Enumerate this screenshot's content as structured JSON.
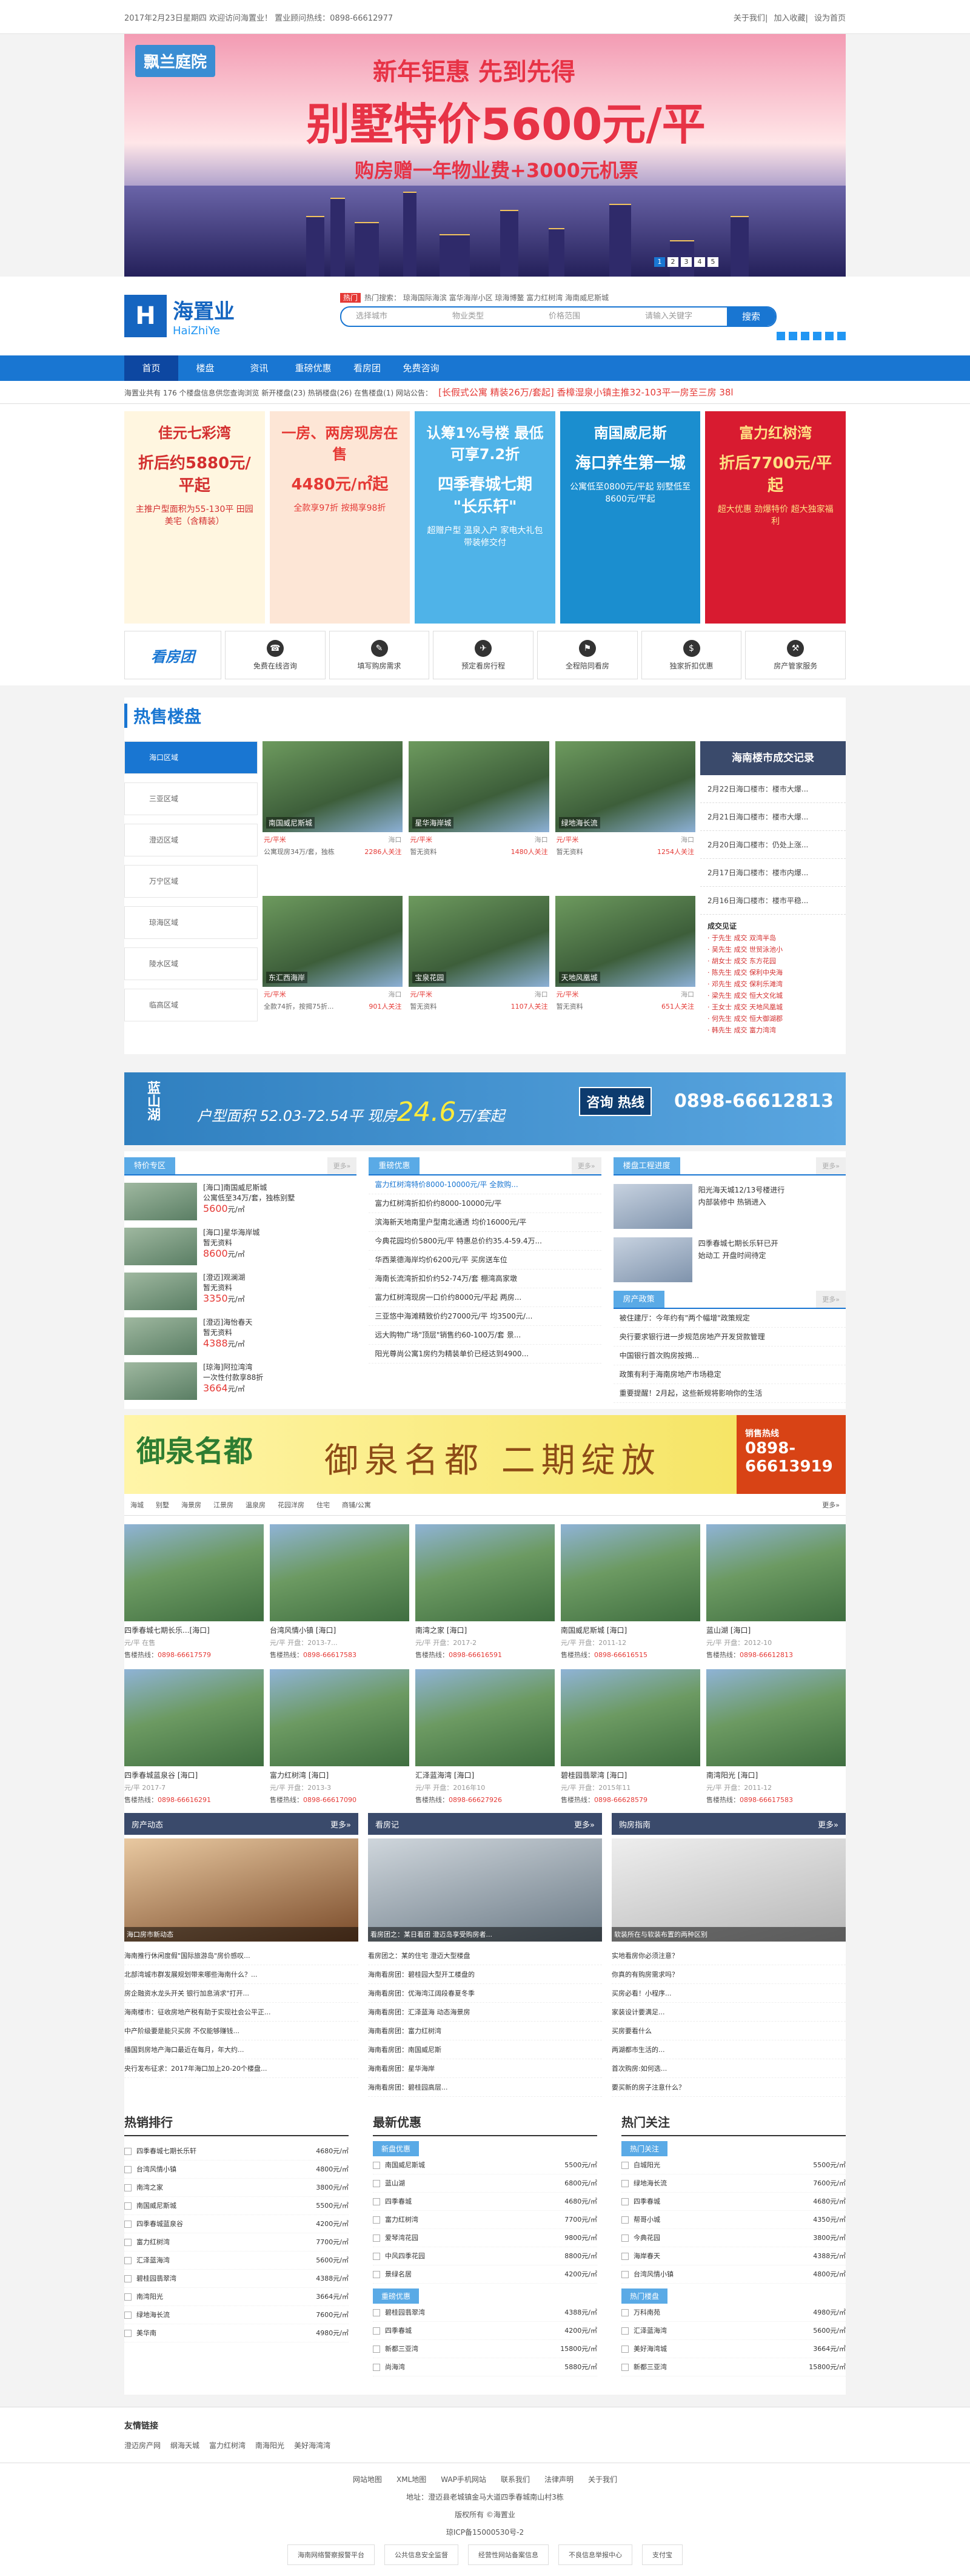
{
  "topbar": {
    "left": "2017年2月23日星期四  欢迎访问海置业！  置业顾问热线：0898-66612977",
    "links": [
      "关于我们",
      "加入收藏",
      "设为首页"
    ]
  },
  "banner": {
    "logo": "飘兰庭院",
    "t1": "新年钜惠 先到先得",
    "t2": "别墅特价5600元/平",
    "t3": "购房赠一年物业费+3000元机票",
    "dots": [
      "1",
      "2",
      "3",
      "4",
      "5"
    ]
  },
  "header": {
    "logo_cn": "海置业",
    "logo_en": "HaiZhiYe",
    "hot_tag": "热门",
    "hot_kw": "热门搜索： 琼海国际海滨  富华海岸小区  琼海博鳌  富力红树湾  海南威尼斯城",
    "s1": "选择城市",
    "s2": "物业类型",
    "s3": "价格范围",
    "s4": "请输入关键字",
    "search_btn": "搜索"
  },
  "nav": [
    "首页",
    "楼盘",
    "资讯",
    "重磅优惠",
    "看房团",
    "免费咨询"
  ],
  "ticker": {
    "text": "海置业共有 176 个楼盘信息供您查询浏览  新开楼盘(23)  热销楼盘(26)  在售楼盘(1)  网站公告：",
    "red": "[长假式公寓 精装26万/套起]   香樟湿泉小镇主推32-103平一房至三房 38l"
  },
  "promos": [
    {
      "a": "佳元七彩湾",
      "b": "折后约5880元/平起",
      "c": "主推户型面积为55-130平 田园美宅（含精装）",
      "bg": "#fff6e0",
      "fg": "#d32f2f"
    },
    {
      "a": "一房、两房现房在售",
      "b": "4480元/㎡起",
      "c": "全款享97折 按揭享98折",
      "bg": "#fde6d6",
      "fg": "#e53935"
    },
    {
      "a": "认筹1%号楼 最低可享7.2折",
      "b": "四季春城七期 \"长乐轩\"",
      "c": "超赠户型 温泉入户 家电大礼包 带装修交付",
      "bg": "#4fb3e8",
      "fg": "#fff"
    },
    {
      "a": "南国威尼斯",
      "b": "海口养生第一城",
      "c": "公寓低至0800元/平起 别墅低至8600元/平起",
      "bg": "#1b8ecf",
      "fg": "#fff"
    },
    {
      "a": "富力红树湾",
      "b": "折后7700元/平起",
      "c": "超大优惠 劲爆特价 超大独家福利",
      "bg": "#d81b30",
      "fg": "#ffe082"
    }
  ],
  "services": {
    "title": "看房团",
    "items": [
      {
        "icon": "phone-icon",
        "glyph": "☎",
        "label": "免费在线咨询"
      },
      {
        "icon": "pen-icon",
        "glyph": "✎",
        "label": "填写购房需求"
      },
      {
        "icon": "plane-icon",
        "glyph": "✈",
        "label": "预定看房行程"
      },
      {
        "icon": "flag-icon",
        "glyph": "⚑",
        "label": "全程陪同看房"
      },
      {
        "icon": "money-icon",
        "glyph": "$",
        "label": "独家折扣优惠"
      },
      {
        "icon": "wrench-icon",
        "glyph": "⚒",
        "label": "房产管家服务"
      }
    ]
  },
  "hot": {
    "title": "热售楼盘",
    "regions": [
      "海口区域",
      "三亚区域",
      "澄迈区域",
      "万宁区域",
      "琼海区域",
      "陵水区域",
      "临高区域"
    ],
    "cards": [
      {
        "name": "南国威尼斯城",
        "price": "元/平米",
        "area": "海口",
        "l2": "公寓现房34万/套，独栋",
        "att": "2286人关注"
      },
      {
        "name": "星华海岸城",
        "price": "元/平米",
        "area": "海口",
        "l2": "暂无资料",
        "att": "1480人关注"
      },
      {
        "name": "绿地海长流",
        "price": "元/平米",
        "area": "海口",
        "l2": "暂无资料",
        "att": "1254人关注"
      },
      {
        "name": "东汇西海岸",
        "price": "元/平米",
        "area": "海口",
        "l2": "全款74折，按揭75折...",
        "att": "901人关注"
      },
      {
        "name": "宝泉花园",
        "price": "元/平米",
        "area": "海口",
        "l2": "暂无资料",
        "att": "1107人关注"
      },
      {
        "name": "天地风凰城",
        "price": "元/平米",
        "area": "海口",
        "l2": "暂无资料",
        "att": "651人关注"
      }
    ]
  },
  "deals": {
    "title": "海南楼市成交记录",
    "items": [
      "2月22日海口楼市：楼市大爆...",
      "2月21日海口楼市：楼市大爆...",
      "2月20日海口楼市：仍处上涨...",
      "2月17日海口楼市：楼市内爆...",
      "2月16日海口楼市：楼市平稳..."
    ],
    "veri_title": "成交见证",
    "veri": [
      "· 于先生 成交 双湾半岛",
      "· 吴先生 成交 世贸泳池小",
      "· 胡女士 成交 东方花园",
      "· 陈先生 成交 保利中央海",
      "· 邓先生 成交 保利乐滩湾",
      "· 梁先生 成交 恒大文化城",
      "· 王女士 成交 天地风凰城",
      "· 何先生 成交 恒大御湖郡",
      "· 韩先生 成交 富力湾湾"
    ]
  },
  "ad2": {
    "a": "蓝山湖",
    "b": "户型面积",
    "nums": "52.03-72.54",
    "c": "0898-66612813",
    "d": "咨询 热线",
    "e": "现房",
    "f": "24.6",
    "g": "万/套起"
  },
  "tejia": {
    "title": "特价专区",
    "items": [
      {
        "a": "[海口]南国威尼斯城",
        "b": "公寓低至34万/套，独栋别墅",
        "p": "5600"
      },
      {
        "a": "[海口]星华海岸城",
        "b": "暂无资料",
        "p": "8600"
      },
      {
        "a": "[澄迈]观澜湖",
        "b": "暂无资料",
        "p": "3350"
      },
      {
        "a": "[澄迈]海怡春天",
        "b": "暂无资料",
        "p": "4388"
      },
      {
        "a": "[琼海]阿拉湾湾",
        "b": "一次性付款享88折",
        "p": "3664"
      }
    ],
    "unit": "元/㎡"
  },
  "youhui": {
    "title": "重磅优惠",
    "items": [
      "富力红树湾特价8000-10000元/平 全款购...",
      "富力红树湾折扣价约8000-10000元/平",
      "滨海新天地南里户型南北通透 均价16000元/平",
      "今典花园均价5800元/平 特惠总价约35.4-59.4万...",
      "华西莱德海岸均价6200元/平 买房送车位",
      "海南长流湾折扣价约52-74万/套 棚湾高家墩",
      "富力红树湾现房一口价约8000元/平起 两房...",
      "三亚悠中海滩精致价约27000元/平 均3500元/...",
      "远大购物广场\"顶层\"销售约60-100万/套 景...",
      "阳光尊尚公寓1房约为精装单价已经达到4900..."
    ]
  },
  "jindu": {
    "title": "楼盘工程进度",
    "items": [
      {
        "a": "阳光海天城12/13号楼进行",
        "b": "内部装修中 热销进入"
      },
      {
        "a": "四季春城七期长乐轩已开",
        "b": "始动工 开盘时间待定"
      }
    ]
  },
  "zhengce": {
    "title": "房产政策",
    "items": [
      "被住建厅：今年约有\"两个幅增\"政策规定",
      "央行要求银行进一步规范房地产开发贷款管理",
      "中国银行首次购房按揭...",
      "政策有利于海南房地产市场稳定",
      "重要提醒！2月起，这些新规将影响你的生活"
    ]
  },
  "ad3": {
    "a": "御泉名都",
    "b": "御泉名都 二期绽放",
    "c": "0898-66613919",
    "d": "销售热线"
  },
  "tabs": [
    "海城",
    "别墅",
    "海景房",
    "江景房",
    "温泉房",
    "花园洋房",
    "住宅",
    "商铺/公寓"
  ],
  "grid": [
    {
      "n": "四季春城七期长乐...[海口]",
      "m": "元/平  在售",
      "t": "0898-66617579"
    },
    {
      "n": "台湾风情小镇 [海口]",
      "m": "元/平  开盘：2013-7...",
      "t": "0898-66617583"
    },
    {
      "n": "南湾之家 [海口]",
      "m": "元/平  开盘：2017-2",
      "t": "0898-66616591"
    },
    {
      "n": "南国威尼斯城 [海口]",
      "m": "元/平  开盘：2011-12",
      "t": "0898-66616515"
    },
    {
      "n": "蓝山湖 [海口]",
      "m": "元/平  开盘：2012-10",
      "t": "0898-66612813"
    },
    {
      "n": "四季春城蓝泉谷 [海口]",
      "m": "元/平  2017-7",
      "t": "0898-66616291"
    },
    {
      "n": "富力红树湾 [海口]",
      "m": "元/平  开盘：2013-3",
      "t": "0898-66617090"
    },
    {
      "n": "汇泽蓝海湾 [海口]",
      "m": "元/平  开盘：2016年10",
      "t": "0898-66627926"
    },
    {
      "n": "碧桂园翡翠湾 [海口]",
      "m": "元/平  开盘：2015年11",
      "t": "0898-66628579"
    },
    {
      "n": "南湾阳光 [海口]",
      "m": "元/平  开盘：2011-12",
      "t": "0898-66617583"
    }
  ],
  "trend": {
    "title": "房产动态",
    "more": "更多»",
    "pic": "海口房市新动态",
    "items": [
      "海南推行休闲度假\"国际旅游岛\"房价感叹...",
      "北部湾城市群发展规划带来哪些海南什么？...",
      "房企融资水龙头开关 银行加息消求\"打开...",
      "海南楼市：征收房地产税有助于实现社会公平正...",
      "中产阶级要是能只买房 不仅能够赚钱...",
      "播国到房地产海口最近在每月，年大约...",
      "央行发布征求：2017年海口加上20-20个楼盘..."
    ]
  },
  "viewlog": {
    "title": "看房记",
    "more": "更多»",
    "pic": "看房团之：某日看团 澄迈岛享受购房者...",
    "items": [
      "看房团之：某的住宅 澄迈大型楼盘",
      "海南看房团：碧桂园大型开工楼盘的",
      "海南看房团：优海湾江阔段春夏冬季",
      "海南看房团：汇泽蓝海 动态海景房",
      "海南看房团：富力红树湾",
      "海南看房团：南国威尼斯",
      "海南看房团：星华海岸",
      "海南看房团：碧桂园高层..."
    ]
  },
  "guide": {
    "title": "购房指南",
    "more": "更多»",
    "pic": "软装所在与软装布置的两种区别",
    "items": [
      "实地看房你必须注意？",
      "你真的有购房需求吗？",
      "买房必看！小程序...",
      "家装设计要满足...",
      "买房要看什么",
      "两湖都市生活的...",
      "首次购房:如何选...",
      "要买新的房子注意什么？"
    ]
  },
  "rank": {
    "r1": {
      "title": "热销排行",
      "items": [
        [
          "四季春城七期长乐轩",
          "4680元/㎡"
        ],
        [
          "台湾风情小镇",
          "4800元/㎡"
        ],
        [
          "南湾之家",
          "3800元/㎡"
        ],
        [
          "南国威尼斯城",
          "5500元/㎡"
        ],
        [
          "四季春城蓝泉谷",
          "4200元/㎡"
        ],
        [
          "富力红树湾",
          "7700元/㎡"
        ],
        [
          "汇泽蓝海湾",
          "5600元/㎡"
        ],
        [
          "碧桂园翡翠湾",
          "4388元/㎡"
        ],
        [
          "南湾阳光",
          "3664元/㎡"
        ],
        [
          "绿地海长流",
          "7600元/㎡"
        ],
        [
          "美华南",
          "4980元/㎡"
        ]
      ]
    },
    "r2": {
      "title": "最新优惠",
      "sub": "新盘优惠",
      "items": [
        [
          "南国威尼斯城",
          "5500元/㎡"
        ],
        [
          "蓝山湖",
          "6800元/㎡"
        ],
        [
          "四季春城",
          "4680元/㎡"
        ],
        [
          "富力红树湾",
          "7700元/㎡"
        ],
        [
          "爱琴湾花园",
          "9800元/㎡"
        ],
        [
          "中风四季花园",
          "8800元/㎡"
        ],
        [
          "景绿名居",
          "4200元/㎡"
        ]
      ],
      "sub2": "重磅优惠",
      "items2": [
        [
          "碧桂园翡翠湾",
          "4388元/㎡"
        ],
        [
          "四季春城",
          "4200元/㎡"
        ],
        [
          "新都三亚湾",
          "15800元/㎡"
        ],
        [
          "尚海湾",
          "5880元/㎡"
        ]
      ]
    },
    "r3": {
      "title": "热门关注",
      "sub": "热门关注",
      "items": [
        [
          "白城阳光",
          "5500元/㎡"
        ],
        [
          "绿地海长流",
          "7600元/㎡"
        ],
        [
          "四季春城",
          "4680元/㎡"
        ],
        [
          "帮哥小城",
          "4350元/㎡"
        ],
        [
          "今典花园",
          "3800元/㎡"
        ],
        [
          "海岸春天",
          "4388元/㎡"
        ],
        [
          "台湾风情小镇",
          "4800元/㎡"
        ]
      ],
      "sub2": "热门楼盘",
      "items2": [
        [
          "万科南苑",
          "4980元/㎡"
        ],
        [
          "汇泽蓝海湾",
          "5600元/㎡"
        ],
        [
          "美好海湾城",
          "3664元/㎡"
        ],
        [
          "新都三亚湾",
          "15800元/㎡"
        ]
      ]
    }
  },
  "links": {
    "title": "友情链接",
    "items": [
      "澄迈房产网",
      "纲海天城",
      "富力红树湾",
      "南海阳光",
      "美好海湾湾"
    ]
  },
  "footer": {
    "links": [
      "网站地图",
      "XML地图",
      "WAP手机网站",
      "联系我们",
      "法律声明",
      "关于我们"
    ],
    "addr": "地址：澄迈县老城镇金马大道四季春城南山村3栋",
    "brand": "版权所有 ©海置业",
    "icp": "琼ICP备15000530号-2",
    "badges": [
      "海南网络警察报警平台",
      "公共信息安全监督",
      "经营性网站备案信息",
      "不良信息举报中心",
      "支付宝"
    ]
  }
}
